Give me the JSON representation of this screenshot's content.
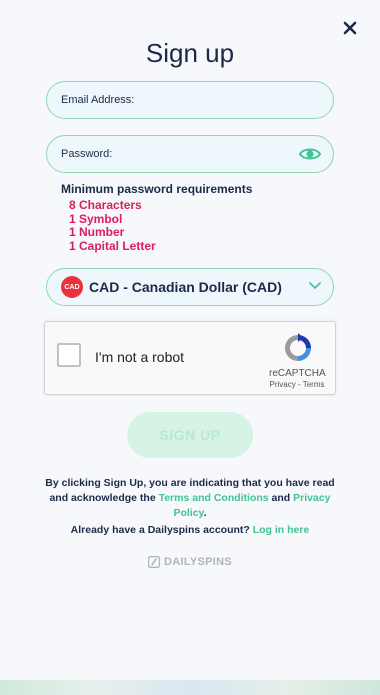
{
  "header": {
    "title": "Sign up"
  },
  "email": {
    "label": "Email Address:",
    "value": ""
  },
  "password": {
    "label": "Password:",
    "value": ""
  },
  "requirements": {
    "title": "Minimum password requirements",
    "items": [
      "8 Characters",
      "1 Symbol",
      "1 Number",
      "1 Capital Letter"
    ]
  },
  "currency": {
    "badge": "CAD",
    "label": "CAD - Canadian Dollar (CAD)"
  },
  "recaptcha": {
    "label": "I'm not a robot",
    "brand": "reCAPTCHA",
    "privacy": "Privacy",
    "separator": " - ",
    "terms": "Terms"
  },
  "signup": {
    "button_label": "SIGN UP"
  },
  "legal": {
    "prefix": "By clicking Sign Up, you are indicating that you have read and acknowledge the ",
    "terms_link": "Terms and Conditions",
    "middle": " and ",
    "privacy_link": "Privacy Policy",
    "suffix": "."
  },
  "login": {
    "prompt": "Already have a Dailyspins account?",
    "link": "Log in here"
  },
  "brand": {
    "name": "DAILYSPINS"
  },
  "colors": {
    "accent": "#3fc492",
    "border": "#8fd6b5",
    "error": "#d81e5b",
    "text": "#1c2a4a"
  },
  "icons": {
    "close": "close-icon",
    "eye": "eye-icon",
    "chevron": "chevron-down-icon",
    "recaptcha": "recaptcha-icon",
    "brand": "dailyspins-logo-icon"
  }
}
